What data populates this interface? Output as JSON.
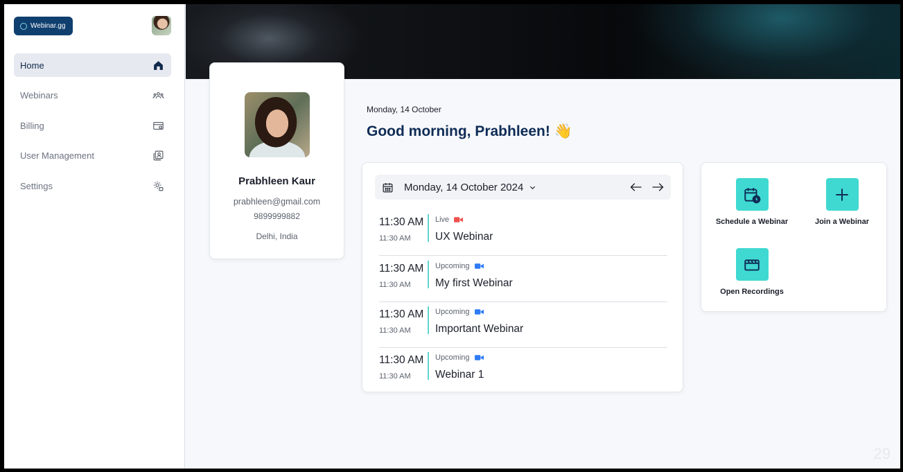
{
  "app": {
    "logo_text": "Webinar.gg"
  },
  "sidebar": {
    "items": [
      {
        "label": "Home",
        "icon": "home-icon",
        "active": true
      },
      {
        "label": "Webinars",
        "icon": "people-icon",
        "active": false
      },
      {
        "label": "Billing",
        "icon": "billing-card-icon",
        "active": false
      },
      {
        "label": "User Management",
        "icon": "user-management-icon",
        "active": false
      },
      {
        "label": "Settings",
        "icon": "settings-gear-icon",
        "active": false
      }
    ]
  },
  "profile": {
    "name": "Prabhleen Kaur",
    "email": "prabhleen@gmail.com",
    "phone": "9899999882",
    "location": "Delhi, India"
  },
  "header": {
    "date": "Monday, 14 October",
    "greeting": "Good morning, Prabhleen! 👋"
  },
  "schedule": {
    "selected_date": "Monday, 14 October 2024",
    "events": [
      {
        "time": "11:30 AM",
        "time_small": "11:30 AM",
        "status": "Live",
        "title": "UX Webinar",
        "status_color": "#f0524f"
      },
      {
        "time": "11:30 AM",
        "time_small": "11:30 AM",
        "status": "Upcoming",
        "title": "My first Webinar",
        "status_color": "#2f7bf5"
      },
      {
        "time": "11:30 AM",
        "time_small": "11:30 AM",
        "status": "Upcoming",
        "title": "Important Webinar",
        "status_color": "#2f7bf5"
      },
      {
        "time": "11:30 AM",
        "time_small": "11:30 AM",
        "status": "Upcoming",
        "title": "Webinar 1",
        "status_color": "#2f7bf5"
      }
    ]
  },
  "actions": {
    "schedule_label": "Schedule a Webinar",
    "join_label": "Join a Webinar",
    "recordings_label": "Open Recordings"
  },
  "colors": {
    "accent": "#3fd9d1",
    "brand": "#0f3f6e",
    "live": "#f0524f",
    "upcoming": "#2f7bf5"
  },
  "corner_number": "29"
}
